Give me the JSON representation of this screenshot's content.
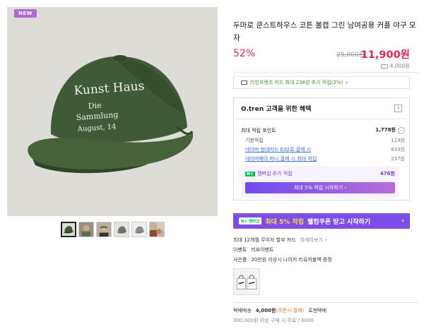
{
  "gallery": {
    "badge": "NEW",
    "cap_text": [
      "Kunst Haus",
      "Die",
      "Sammlung",
      "August, 14"
    ],
    "thumbnail_count": 6,
    "active_thumbnail": 1
  },
  "product": {
    "title": "두마로 쿤스트하우스 코튼 볼캡 그린 남여공용 커플 야구 모자",
    "discount": "52%",
    "original_price": "25,000원",
    "sale_price": "11,900원",
    "shipping_fee": "4,000원"
  },
  "card_notice": "라인프렌즈 카드 최대 238원 추가 적립(2%)",
  "benefit": {
    "title": "O.tren 고객을 위한 혜택",
    "help": "?",
    "max_points_label": "최대 적립 포인트",
    "max_points_value": "1,778원",
    "rows": [
      {
        "label": "기본적립",
        "value": "119원"
      },
      {
        "label": "네이버 현대카드 Ed2로 결제 시",
        "value": "833원"
      },
      {
        "label": "네이버페이 머니 결제 시 최대 적립",
        "value": "237원"
      }
    ],
    "membership_label": "멤버십 추가 적립",
    "membership_value": "476원",
    "membership_button": "최대 5% 적립 시작하기 ›"
  },
  "promo": {
    "tag": "N+ 멤버십",
    "highlight": "최대 5% 적립",
    "text": "웰컴쿠폰 받고 시작하기",
    "chevron": "›"
  },
  "installment": {
    "text": "최대 12개월 무이자 할부 카드",
    "link": "자세히보기 ›"
  },
  "event": {
    "label": "이벤트",
    "value": "리뷰이벤트"
  },
  "gift": {
    "label": "사은품",
    "value": "20만원 이상시 나이키 리유저블백 증정"
  },
  "delivery": {
    "label": "택배배송",
    "fee": "4,000원",
    "fee_note": "(주문시 결제)",
    "carrier": "로젠택배",
    "condition": "300,000원 이상 구매 시 무료 / 6000"
  },
  "colors": {
    "accent": "#e8254d",
    "naver_green": "#03c75a",
    "purple": "#7c4ee8",
    "cap_green": "#3f5b35"
  }
}
